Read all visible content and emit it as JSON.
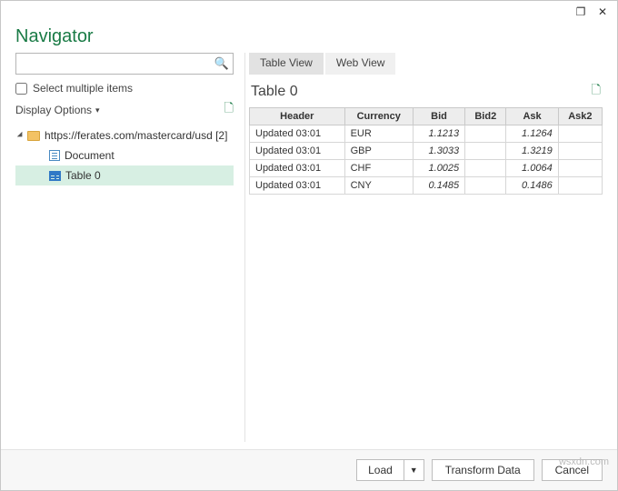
{
  "window": {
    "title": "Navigator",
    "restore_icon": "❐",
    "close_icon": "✕"
  },
  "left": {
    "search_placeholder": "",
    "select_multiple": "Select multiple items",
    "display_options": "Display Options",
    "tree": {
      "root_label": "https://ferates.com/mastercard/usd [2]",
      "child_doc": "Document",
      "child_table": "Table 0"
    }
  },
  "tabs": {
    "table_view": "Table View",
    "web_view": "Web View"
  },
  "preview": {
    "title": "Table 0",
    "columns": [
      "Header",
      "Currency",
      "Bid",
      "Bid2",
      "Ask",
      "Ask2"
    ],
    "rows": [
      {
        "header": "Updated 03:01",
        "currency": "EUR",
        "bid": "1.1213",
        "bid2": "",
        "ask": "1.1264",
        "ask2": ""
      },
      {
        "header": "Updated 03:01",
        "currency": "GBP",
        "bid": "1.3033",
        "bid2": "",
        "ask": "1.3219",
        "ask2": ""
      },
      {
        "header": "Updated 03:01",
        "currency": "CHF",
        "bid": "1.0025",
        "bid2": "",
        "ask": "1.0064",
        "ask2": ""
      },
      {
        "header": "Updated 03:01",
        "currency": "CNY",
        "bid": "0.1485",
        "bid2": "",
        "ask": "0.1486",
        "ask2": ""
      }
    ]
  },
  "footer": {
    "load": "Load",
    "transform": "Transform Data",
    "cancel": "Cancel"
  },
  "watermark": "wsxdn.com"
}
